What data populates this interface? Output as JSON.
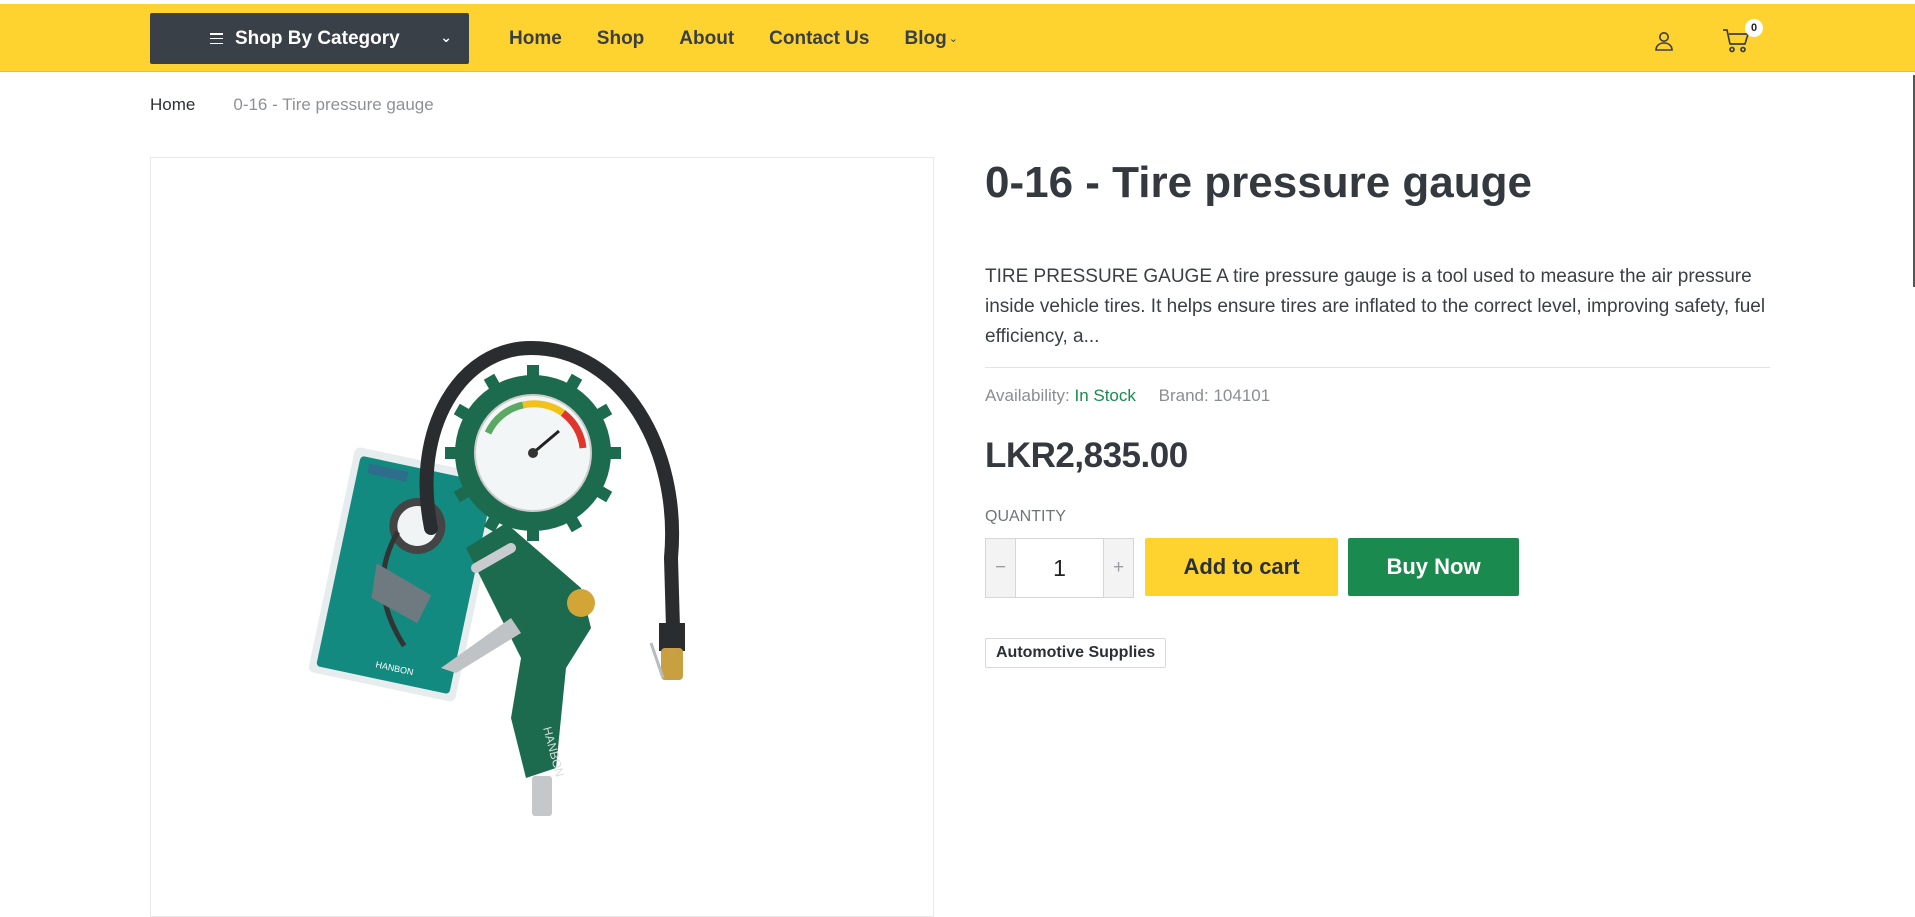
{
  "header": {
    "category_button": "Shop By Category",
    "nav": [
      "Home",
      "Shop",
      "About",
      "Contact Us",
      "Blog"
    ],
    "cart_count": "0",
    "icons": {
      "menu": "hamburger-icon",
      "dropdown": "chevron-down-icon",
      "account": "user-icon",
      "cart": "cart-icon"
    }
  },
  "breadcrumb": {
    "home": "Home",
    "current": "0-16 - Tire pressure gauge"
  },
  "product": {
    "title": "0-16 - Tire pressure gauge",
    "description": "TIRE PRESSURE GAUGE A tire pressure gauge is a tool used to measure the air pressure inside vehicle tires. It helps ensure tires are inflated to the correct level, improving safety, fuel efficiency, a...",
    "availability_label": "Availability:",
    "availability_value": "In Stock",
    "brand_label": "Brand:",
    "brand_value": "104101",
    "price": "LKR2,835.00",
    "quantity_label": "QUANTITY",
    "quantity_value": "1",
    "minus": "−",
    "plus": "+",
    "add_to_cart": "Add to cart",
    "buy_now": "Buy Now",
    "category_tag": "Automotive Supplies",
    "image_logo_text": "HANBON"
  },
  "colors": {
    "accent": "#fed330",
    "dark": "#3a4047",
    "success": "#1a8a4e"
  }
}
